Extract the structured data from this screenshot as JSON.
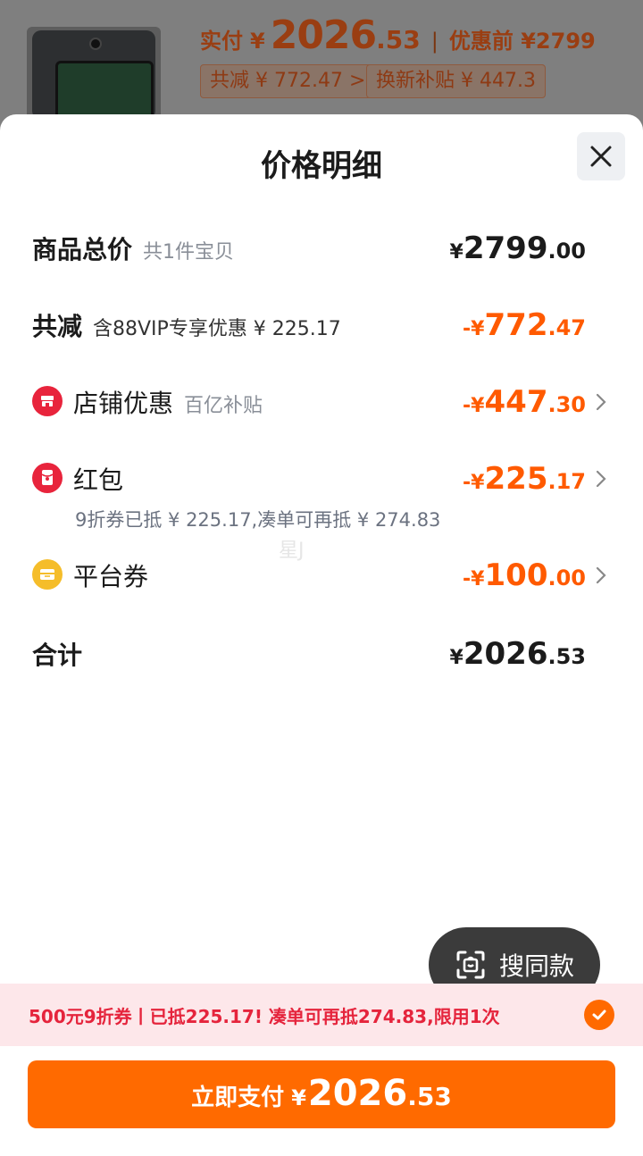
{
  "header": {
    "pay_label": "实付",
    "currency": "¥",
    "pay_int": "2026",
    "pay_dec": ".53",
    "separator": "|",
    "original_label": "优惠前 ¥2799",
    "chip_total_discount": "共减 ¥ 772.47 >",
    "chip_tradein": "换新补贴 ¥ 447.3"
  },
  "sheet": {
    "title": "价格明细"
  },
  "rows": {
    "total": {
      "label": "商品总价",
      "sub": "共1件宝贝",
      "yen": "¥",
      "int": "2799",
      "dec": ".00"
    },
    "discount": {
      "label": "共减",
      "sub": "含88VIP专享优惠 ¥ 225.17",
      "yen": "-¥",
      "int": "772",
      "dec": ".47"
    },
    "store": {
      "label": "店铺优惠",
      "sub": "百亿补贴",
      "yen": "-¥",
      "int": "447",
      "dec": ".30"
    },
    "redpacket": {
      "label": "红包",
      "sub": "9折券已抵 ¥ 225.17,凑单可再抵 ¥ 274.83",
      "yen": "-¥",
      "int": "225",
      "dec": ".17"
    },
    "platform": {
      "label": "平台券",
      "yen": "-¥",
      "int": "100",
      "dec": ".00"
    },
    "sum": {
      "label": "合计",
      "yen": "¥",
      "int": "2026",
      "dec": ".53"
    }
  },
  "watermark": "星J",
  "search_same_label": "搜同款",
  "coupon_bar": {
    "text": "500元9折券丨已抵225.17! 凑单可再抵274.83,限用1次"
  },
  "pay_button": {
    "label": "立即支付",
    "yen": "¥",
    "int": "2026",
    "dec": ".53"
  },
  "colors": {
    "accent": "#ff6a00",
    "discount": "#ff5a00",
    "coupon_text": "#e5243c",
    "store_icon": "#e8243c",
    "redpacket_icon": "#e8243c",
    "platform_icon": "#f5bd2a"
  }
}
